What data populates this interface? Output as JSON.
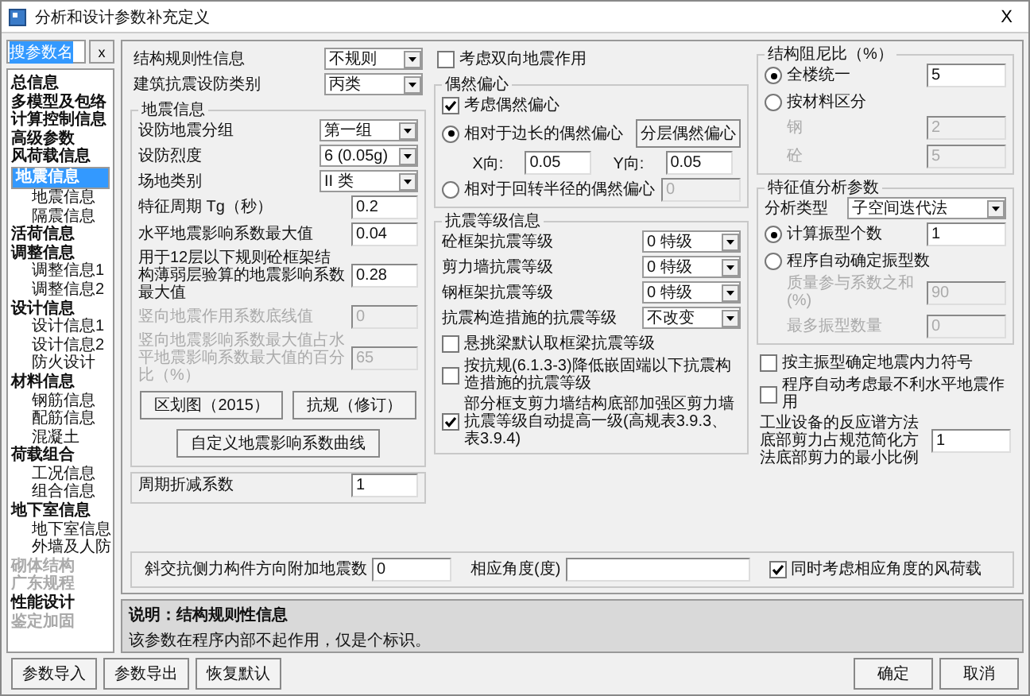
{
  "window": {
    "title": "分析和设计参数补充定义",
    "close": "X"
  },
  "sidebar": {
    "search": {
      "value": "搜参数名",
      "text_selected": true
    },
    "clear_button": "x",
    "items": [
      {
        "label": "总信息",
        "selected": false,
        "disabled": false
      },
      {
        "label": "多模型及包络",
        "selected": false,
        "disabled": false
      },
      {
        "label": "计算控制信息",
        "selected": false,
        "disabled": false
      },
      {
        "label": "高级参数",
        "selected": false,
        "disabled": false
      },
      {
        "label": "风荷载信息",
        "selected": false,
        "disabled": false
      },
      {
        "label": "地震信息",
        "selected": true,
        "disabled": false,
        "children": [
          {
            "label": "地震信息",
            "selected": false,
            "disabled": false
          },
          {
            "label": "隔震信息",
            "selected": false,
            "disabled": false
          }
        ]
      },
      {
        "label": "活荷信息",
        "selected": false,
        "disabled": false
      },
      {
        "label": "调整信息",
        "selected": false,
        "disabled": false,
        "children": [
          {
            "label": "调整信息1",
            "selected": false,
            "disabled": false
          },
          {
            "label": "调整信息2",
            "selected": false,
            "disabled": false
          }
        ]
      },
      {
        "label": "设计信息",
        "selected": false,
        "disabled": false,
        "children": [
          {
            "label": "设计信息1",
            "selected": false,
            "disabled": false
          },
          {
            "label": "设计信息2",
            "selected": false,
            "disabled": false
          },
          {
            "label": "防火设计",
            "selected": false,
            "disabled": false
          }
        ]
      },
      {
        "label": "材料信息",
        "selected": false,
        "disabled": false,
        "children": [
          {
            "label": "钢筋信息",
            "selected": false,
            "disabled": false
          },
          {
            "label": "配筋信息",
            "selected": false,
            "disabled": false
          },
          {
            "label": "混凝土",
            "selected": false,
            "disabled": false
          }
        ]
      },
      {
        "label": "荷载组合",
        "selected": false,
        "disabled": false,
        "children": [
          {
            "label": "工况信息",
            "selected": false,
            "disabled": false
          },
          {
            "label": "组合信息",
            "selected": false,
            "disabled": false
          }
        ]
      },
      {
        "label": "地下室信息",
        "selected": false,
        "disabled": false,
        "children": [
          {
            "label": "地下室信息",
            "selected": false,
            "disabled": false
          },
          {
            "label": "外墙及人防",
            "selected": false,
            "disabled": false
          }
        ]
      },
      {
        "label": "砌体结构",
        "selected": false,
        "disabled": true
      },
      {
        "label": "广东规程",
        "selected": false,
        "disabled": true
      },
      {
        "label": "性能设计",
        "selected": false,
        "disabled": false
      },
      {
        "label": "鉴定加固",
        "selected": false,
        "disabled": true
      }
    ]
  },
  "columns": [
    [
      {
        "kind": "plain",
        "items": [
          {
            "kind": "select",
            "label": "结构规则性信息",
            "value": "不规则"
          },
          {
            "kind": "select",
            "label": "建筑抗震设防类别",
            "value": "丙类"
          }
        ]
      },
      {
        "kind": "group",
        "title": "地震信息",
        "items": [
          {
            "kind": "select",
            "label": "设防地震分组",
            "value": "第一组"
          },
          {
            "kind": "select",
            "label": "设防烈度",
            "value": "6 (0.05g)"
          },
          {
            "kind": "select",
            "label": "场地类别",
            "value": "II 类"
          },
          {
            "kind": "input",
            "label": "特征周期 Tg（秒）",
            "value": "0.2",
            "disabled": false
          },
          {
            "kind": "input",
            "label": "水平地震影响系数最大值",
            "value": "0.04",
            "disabled": false
          },
          {
            "kind": "input",
            "label": "用于12层以下规则砼框架结构薄弱层验算的地震影响系数最大值",
            "value": "0.28",
            "disabled": false
          },
          {
            "kind": "input",
            "label": "竖向地震作用系数底线值",
            "value": "0",
            "disabled": true
          },
          {
            "kind": "input",
            "label": "竖向地震影响系数最大值占水平地震影响系数最大值的百分比（%）",
            "value": "65",
            "disabled": true
          },
          {
            "kind": "buttons",
            "buttons": [
              "区划图（2015）",
              "抗规（修订）"
            ]
          },
          {
            "kind": "buttons",
            "buttons": [
              "自定义地震影响系数曲线"
            ]
          }
        ]
      },
      {
        "kind": "group",
        "items": [
          {
            "kind": "input",
            "label": "周期折减系数",
            "value": "1",
            "disabled": false
          }
        ]
      }
    ],
    [
      {
        "kind": "plain",
        "items": [
          {
            "kind": "checkbox",
            "label": "考虑双向地震作用",
            "checked": false
          }
        ]
      },
      {
        "kind": "group",
        "title": "偶然偏心",
        "items": [
          {
            "kind": "checkbox",
            "label": "考虑偶然偏心",
            "checked": true
          },
          {
            "kind": "radio",
            "label": "相对于边长的偶然偏心",
            "selected": true,
            "button": "分层偶然偏心",
            "children": [
              {
                "kind": "pair",
                "fields": [
                  {
                    "label": "X向:",
                    "value": "0.05"
                  },
                  {
                    "label": "Y向:",
                    "value": "0.05"
                  }
                ]
              }
            ]
          },
          {
            "kind": "radio",
            "label": "相对于回转半径的偶然偏心",
            "selected": false,
            "value": "0",
            "value_disabled": true
          }
        ]
      },
      {
        "kind": "group",
        "title": "抗震等级信息",
        "items": [
          {
            "kind": "select",
            "label": "砼框架抗震等级",
            "value": "0  特级"
          },
          {
            "kind": "select",
            "label": "剪力墙抗震等级",
            "value": "0  特级"
          },
          {
            "kind": "select",
            "label": "钢框架抗震等级",
            "value": "0  特级"
          },
          {
            "kind": "select",
            "label": "抗震构造措施的抗震等级",
            "value": "不改变"
          },
          {
            "kind": "checkbox",
            "label": "悬挑梁默认取框梁抗震等级",
            "checked": false
          },
          {
            "kind": "checkbox",
            "label": "按抗规(6.1.3-3)降低嵌固端以下抗震构造措施的抗震等级",
            "checked": false
          },
          {
            "kind": "checkbox",
            "label": "部分框支剪力墙结构底部加强区剪力墙抗震等级自动提高一级(高规表3.9.3、表3.9.4)",
            "checked": true
          }
        ]
      }
    ],
    [
      {
        "kind": "group",
        "title": "结构阻尼比（%）",
        "items": [
          {
            "kind": "radio",
            "label": "全楼统一",
            "selected": true,
            "value": "5",
            "value_disabled": false
          },
          {
            "kind": "radio",
            "label": "按材料区分",
            "selected": false,
            "children": [
              {
                "kind": "input",
                "label": "钢",
                "value": "2",
                "disabled": true
              },
              {
                "kind": "input",
                "label": "砼",
                "value": "5",
                "disabled": true
              }
            ]
          }
        ]
      },
      {
        "kind": "group",
        "title": "特征值分析参数",
        "items": [
          {
            "kind": "select",
            "label": "分析类型",
            "value": "子空间迭代法"
          },
          {
            "kind": "radio",
            "label": "计算振型个数",
            "selected": true,
            "value": "1",
            "value_disabled": false
          },
          {
            "kind": "radio",
            "label": "程序自动确定振型数",
            "selected": false,
            "children": [
              {
                "kind": "input",
                "label": "质量参与系数之和(%)",
                "value": "90",
                "disabled": true
              },
              {
                "kind": "input",
                "label": "最多振型数量",
                "value": "0",
                "disabled": true
              }
            ]
          }
        ]
      },
      {
        "kind": "plain",
        "items": [
          {
            "kind": "checkbox",
            "label": "按主振型确定地震内力符号",
            "checked": false
          },
          {
            "kind": "checkbox",
            "label": "程序自动考虑最不利水平地震作用",
            "checked": false
          },
          {
            "kind": "input",
            "label": "工业设备的反应谱方法底部剪力占规范简化方法底部剪力的最小比例",
            "value": "1",
            "disabled": false
          }
        ]
      }
    ]
  ],
  "bottom_row": [
    {
      "kind": "input",
      "label": "斜交抗侧力构件方向附加地震数",
      "value": "0",
      "disabled": false
    },
    {
      "kind": "input",
      "label": "相应角度(度)",
      "disabled": false
    },
    {
      "kind": "checkbox",
      "label": "同时考虑相应角度的风荷载",
      "checked": true
    }
  ],
  "description": {
    "title": "说明：结构规则性信息",
    "text": "该参数在程序内部不起作用，仅是个标识。"
  },
  "buttons_left": [
    "参数导入",
    "参数导出",
    "恢复默认"
  ],
  "buttons_right": [
    "确定",
    "取消"
  ]
}
